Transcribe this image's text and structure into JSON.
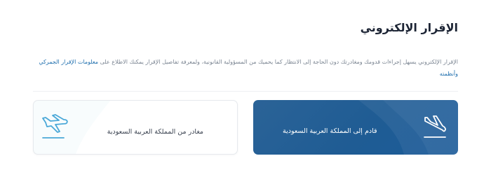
{
  "section": {
    "title": "الإقرار الإلكتروني",
    "description": "الإقرار الإلكتروني يسهل إجراءات قدومك ومغادرتك دون الحاجة إلى الانتظار كما يحميك من المسؤولية القانونية، ولمعرفة تفاصيل الإقرار يمكنك الاطلاع على ",
    "link_text": "معلومات الإقرار الجمركي وأنظمته"
  },
  "cards": {
    "arrival": {
      "label": "قادم إلى المملكة العربية السعودية",
      "icon": "airplane-landing-icon"
    },
    "departure": {
      "label": "مغادر من المملكة العربية السعودية",
      "icon": "airplane-takeoff-icon"
    }
  },
  "colors": {
    "title": "#1c2434",
    "link": "#1f6fae",
    "arrival_card": "#1f5c94",
    "departure_icon": "#4aa8d8"
  }
}
